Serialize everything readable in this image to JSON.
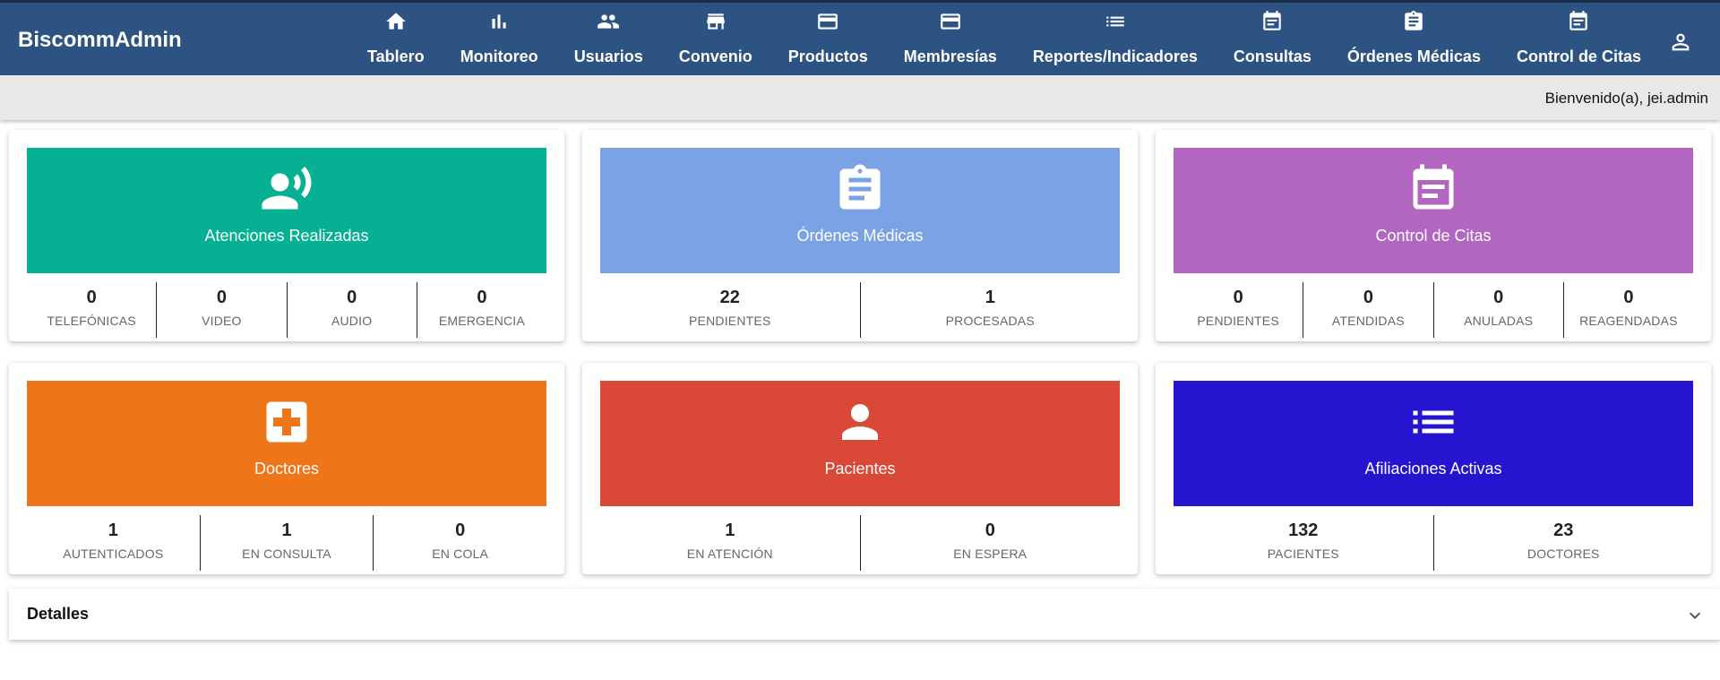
{
  "header": {
    "brand": "BiscommAdmin",
    "nav": [
      {
        "label": "Tablero",
        "icon": "home-icon"
      },
      {
        "label": "Monitoreo",
        "icon": "bar-chart-icon"
      },
      {
        "label": "Usuarios",
        "icon": "people-icon"
      },
      {
        "label": "Convenio",
        "icon": "store-icon"
      },
      {
        "label": "Productos",
        "icon": "card-icon"
      },
      {
        "label": "Membresías",
        "icon": "card-icon"
      },
      {
        "label": "Reportes/Indicadores",
        "icon": "list-icon"
      },
      {
        "label": "Consultas",
        "icon": "event-note-icon"
      },
      {
        "label": "Órdenes Médicas",
        "icon": "assignment-icon"
      },
      {
        "label": "Control de Citas",
        "icon": "event-note-icon"
      }
    ],
    "user_icon": "account-icon"
  },
  "welcome": "Bienvenido(a), jei.admin",
  "colors": {
    "topbar": "#2d5382",
    "atenciones": "#06b093",
    "ordenes": "#7aa2e4",
    "citas": "#b366c0",
    "doctores": "#ef7618",
    "pacientes": "#da4837",
    "afiliaciones": "#2615d0"
  },
  "cards": {
    "atenciones": {
      "title": "Atenciones Realizadas",
      "icon": "record-voice-icon",
      "stats": [
        {
          "value": "0",
          "label": "TELEFÓNICAS"
        },
        {
          "value": "0",
          "label": "VIDEO"
        },
        {
          "value": "0",
          "label": "AUDIO"
        },
        {
          "value": "0",
          "label": "EMERGENCIA"
        }
      ]
    },
    "ordenes": {
      "title": "Órdenes Médicas",
      "icon": "assignment-icon",
      "stats": [
        {
          "value": "22",
          "label": "PENDIENTES"
        },
        {
          "value": "1",
          "label": "PROCESADAS"
        }
      ]
    },
    "citas": {
      "title": "Control de Citas",
      "icon": "event-note-icon",
      "stats": [
        {
          "value": "0",
          "label": "PENDIENTES"
        },
        {
          "value": "0",
          "label": "ATENDIDAS"
        },
        {
          "value": "0",
          "label": "ANULADAS"
        },
        {
          "value": "0",
          "label": "REAGENDADAS"
        }
      ]
    },
    "doctores": {
      "title": "Doctores",
      "icon": "medical-cross-icon",
      "stats": [
        {
          "value": "1",
          "label": "AUTENTICADOS"
        },
        {
          "value": "1",
          "label": "EN CONSULTA"
        },
        {
          "value": "0",
          "label": "EN COLA"
        }
      ]
    },
    "pacientes": {
      "title": "Pacientes",
      "icon": "person-icon",
      "stats": [
        {
          "value": "1",
          "label": "EN ATENCIÓN"
        },
        {
          "value": "0",
          "label": "EN ESPERA"
        }
      ]
    },
    "afiliaciones": {
      "title": "Afiliaciones Activas",
      "icon": "list-icon",
      "stats": [
        {
          "value": "132",
          "label": "PACIENTES"
        },
        {
          "value": "23",
          "label": "DOCTORES"
        }
      ]
    }
  },
  "details": {
    "label": "Detalles",
    "icon": "chevron-down-icon"
  }
}
